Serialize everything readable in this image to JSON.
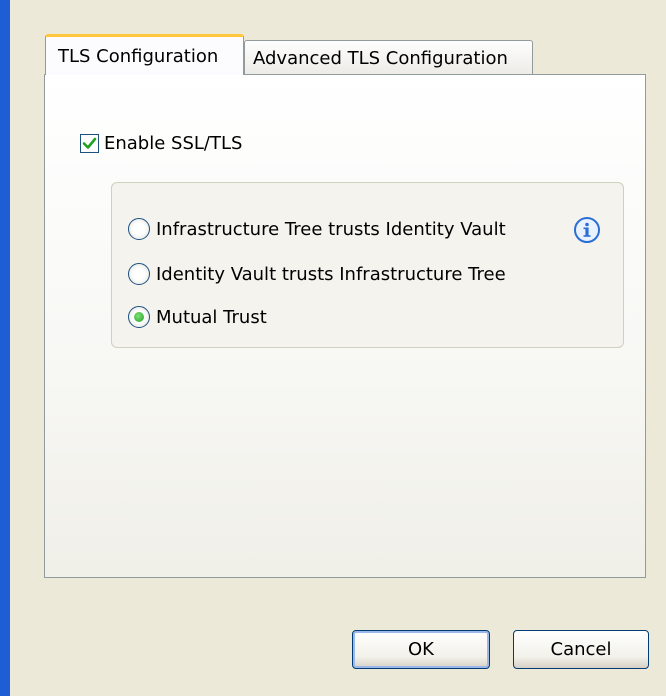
{
  "tabs": [
    {
      "label": "TLS Configuration",
      "selected": true
    },
    {
      "label": "Advanced TLS Configuration",
      "selected": false
    }
  ],
  "enable_ssl": {
    "label": "Enable SSL/TLS",
    "checked": true
  },
  "trust_options": [
    {
      "label": "Infrastructure Tree trusts Identity Vault",
      "selected": false
    },
    {
      "label": "Identity Vault trusts Infrastructure Tree",
      "selected": false
    },
    {
      "label": "Mutual Trust",
      "selected": true
    }
  ],
  "info_icon": "info-icon",
  "buttons": {
    "ok": "OK",
    "cancel": "Cancel"
  },
  "colors": {
    "window_border": "#1f5dd4",
    "active_tab_accent": "#ffc83c",
    "check_color": "#21a121"
  }
}
